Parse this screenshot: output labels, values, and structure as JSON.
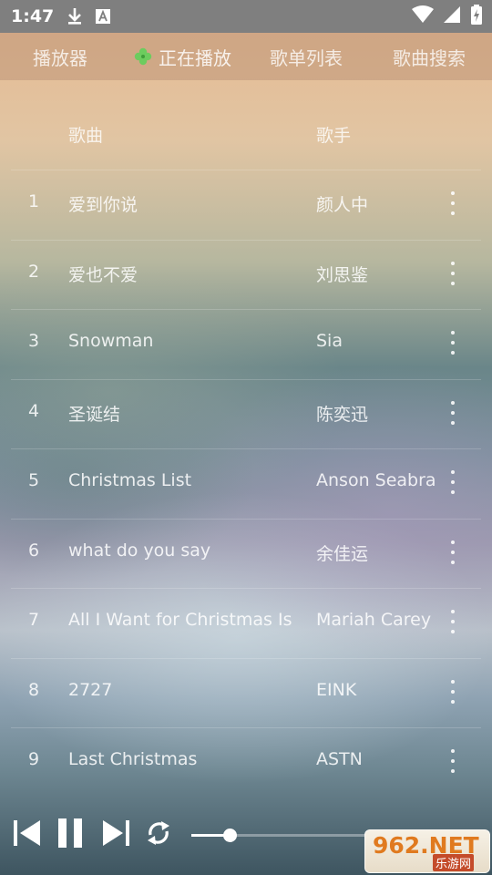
{
  "status_bar": {
    "time": "1:47",
    "icons": [
      "download-icon",
      "font-a-icon",
      "wifi-icon",
      "signal-icon",
      "battery-charging-icon"
    ]
  },
  "nav": {
    "tabs": [
      {
        "label": "播放器"
      },
      {
        "label": "正在播放",
        "icon": "clover-icon",
        "active": true
      },
      {
        "label": "歌单列表"
      },
      {
        "label": "歌曲搜索"
      }
    ]
  },
  "table": {
    "headers": {
      "song": "歌曲",
      "artist": "歌手"
    },
    "rows": [
      {
        "num": "1",
        "song": "爱到你说",
        "artist": "颜人中"
      },
      {
        "num": "2",
        "song": "爱也不爱",
        "artist": "刘思鉴"
      },
      {
        "num": "3",
        "song": "Snowman",
        "artist": "Sia"
      },
      {
        "num": "4",
        "song": "圣诞结",
        "artist": "陈奕迅"
      },
      {
        "num": "5",
        "song": "Christmas List",
        "artist": "Anson Seabra"
      },
      {
        "num": "6",
        "song": "what do you say",
        "artist": "余佳运"
      },
      {
        "num": "7",
        "song": "All I Want for Christmas Is",
        "artist": "Mariah Carey"
      },
      {
        "num": "8",
        "song": "2727",
        "artist": "EINK"
      },
      {
        "num": "9",
        "song": "Last Christmas",
        "artist": "ASTN"
      }
    ]
  },
  "player": {
    "controls": [
      "previous-icon",
      "pause-icon",
      "next-icon",
      "repeat-icon"
    ],
    "progress": 0.14
  },
  "watermark": {
    "brand": "962.NET",
    "site": "乐游网"
  }
}
